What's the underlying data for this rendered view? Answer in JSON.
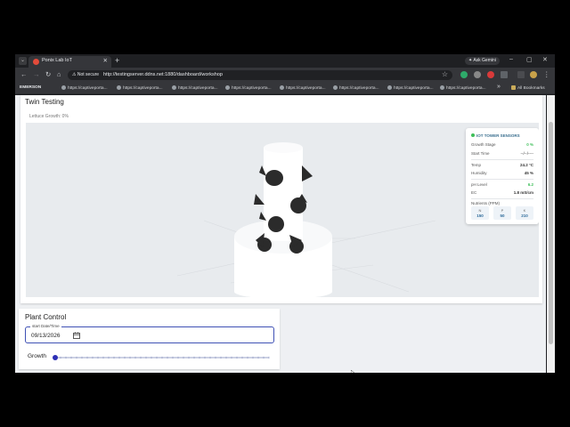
{
  "browser": {
    "tab_menu_icon": "chevron-down-icon",
    "tab_title": "Ponix Lab IoT",
    "new_tab": "+",
    "ask_gemini": "Ask Gemini",
    "window_controls": [
      "–",
      "▢",
      "✕"
    ],
    "not_secure": "Not secure",
    "url": "http://testingserver.ddns.net:1880/dashboard/workshop",
    "bookmarks": {
      "first": "EMERSON",
      "items": [
        "https://captiveporta...",
        "https://captiveporta...",
        "https://captiveporta...",
        "https://captiveporta...",
        "https://captiveporta...",
        "https://captiveporta...",
        "https://captiveporta...",
        "https://captiveporta..."
      ],
      "overflow": "»",
      "all_bookmarks": "All Bookmarks"
    }
  },
  "twin": {
    "title": "Twin Testing",
    "lettuce_growth": "Lettuce Growth: 0%"
  },
  "sensors": {
    "header": "IOT TOWER SENSORS",
    "growth_stage_label": "Growth Stage",
    "growth_stage_value": "0 %",
    "start_time_label": "Start Time",
    "start_time_value": "--/--/----",
    "temp_label": "Temp",
    "temp_value": "24.2 °C",
    "humidity_label": "Humidity",
    "humidity_value": "45 %",
    "ph_label": "pH Level",
    "ph_value": "6.2",
    "ec_label": "EC",
    "ec_value": "1.8 mS/cm",
    "nutrients_label": "Nutrients (PPM)",
    "nutrients": [
      {
        "label": "N",
        "value": "150"
      },
      {
        "label": "P",
        "value": "50"
      },
      {
        "label": "K",
        "value": "210"
      }
    ],
    "colors": {
      "ok": "#3fbf5a",
      "value": "#2d6a9a"
    }
  },
  "plant_control": {
    "title": "Plant Control",
    "date_legend": "start Date/Time",
    "date_value": "09/13/2026",
    "growth_label": "Growth",
    "growth_value": 0
  }
}
